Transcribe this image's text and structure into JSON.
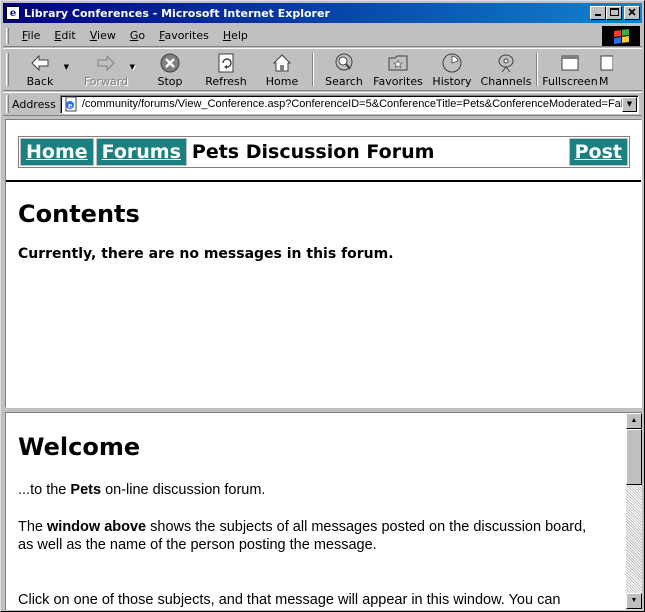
{
  "window": {
    "title": "Library Conferences - Microsoft Internet Explorer"
  },
  "menu": [
    {
      "key": "F",
      "rest": "ile"
    },
    {
      "key": "E",
      "rest": "dit"
    },
    {
      "key": "V",
      "rest": "iew"
    },
    {
      "key": "G",
      "rest": "o"
    },
    {
      "key": "F",
      "rest": "avorites",
      "pre": ""
    },
    {
      "key": "H",
      "rest": "elp"
    }
  ],
  "toolbar": {
    "back": "Back",
    "forward": "Forward",
    "stop": "Stop",
    "refresh": "Refresh",
    "home": "Home",
    "search": "Search",
    "favorites": "Favorites",
    "history": "History",
    "channels": "Channels",
    "fullscreen": "Fullscreen",
    "mail": "M"
  },
  "address": {
    "label": "Address",
    "url": "/community/forums/View_Conference.asp?ConferenceID=5&ConferenceTitle=Pets&ConferenceModerated=False"
  },
  "nav": {
    "home": "Home",
    "forums": "Forums",
    "title": "Pets Discussion Forum",
    "post": "Post"
  },
  "contents": {
    "heading": "Contents",
    "empty_message": "Currently, there are no messages in this forum."
  },
  "welcome": {
    "heading": "Welcome",
    "line1_pre": "...to the ",
    "line1_bold": "Pets",
    "line1_post": " on-line discussion forum.",
    "p2_pre": "The ",
    "p2_bold": "window above",
    "p2_post": " shows the subjects of all messages posted on the discussion board,",
    "p2_line2": "as well as the name of the person posting the message.",
    "p3": "Click on one of those subjects, and that message will appear in this window. You can"
  },
  "colors": {
    "nav_bg": "#1a8080",
    "title_bar_start": "#000080",
    "title_bar_end": "#1084d0"
  }
}
